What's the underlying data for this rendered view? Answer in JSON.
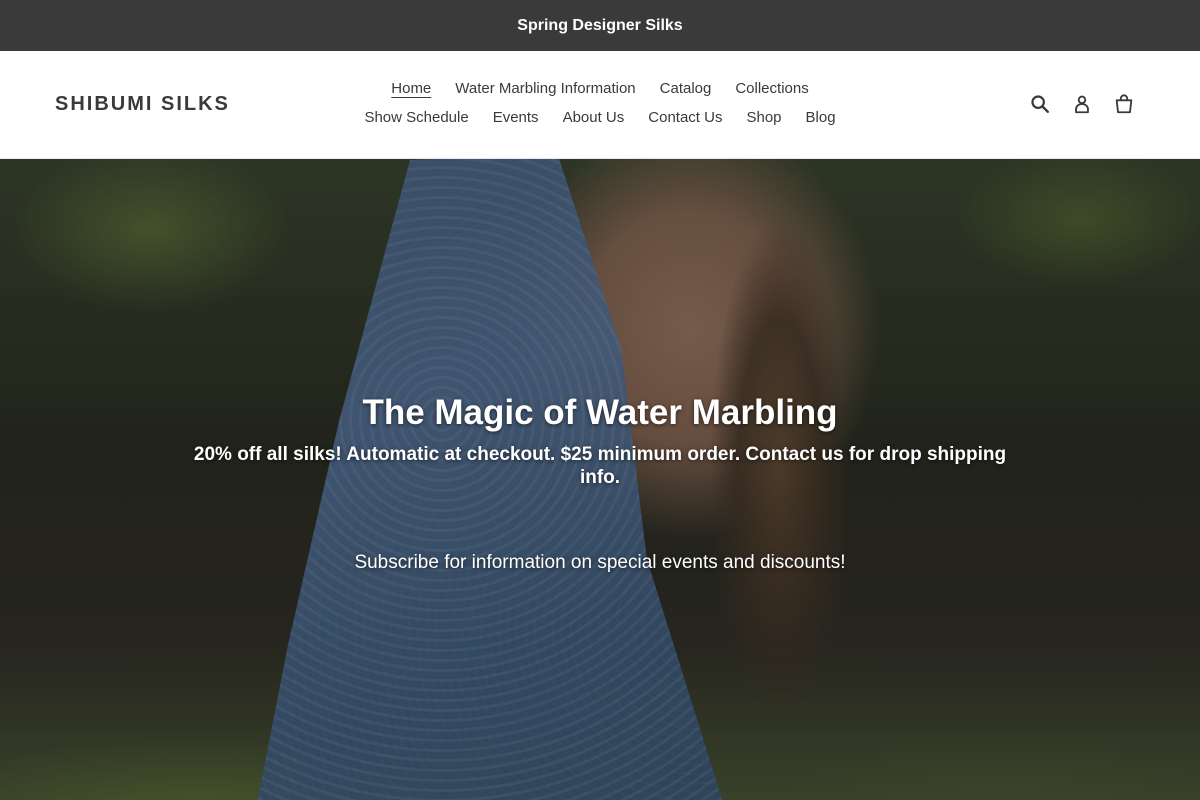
{
  "announcement": {
    "text": "Spring Designer Silks"
  },
  "header": {
    "logo": "SHIBUMI SILKS",
    "nav_row1": [
      {
        "label": "Home",
        "active": true
      },
      {
        "label": "Water Marbling Information"
      },
      {
        "label": "Catalog"
      },
      {
        "label": "Collections"
      }
    ],
    "nav_row2": [
      {
        "label": "Show Schedule"
      },
      {
        "label": "Events"
      },
      {
        "label": "About Us"
      },
      {
        "label": "Contact Us"
      },
      {
        "label": "Shop"
      },
      {
        "label": "Blog"
      }
    ],
    "icons": [
      "search-icon",
      "account-icon",
      "cart-icon"
    ]
  },
  "hero": {
    "title": "The Magic of Water Marbling",
    "subtitle": "20% off all silks! Automatic at checkout. $25 minimum order. Contact us for drop shipping info.",
    "subscribe_text": "Subscribe for information on special events and discounts!"
  },
  "colors": {
    "announcement_bg": "#3a3a3a",
    "text_dark": "#3a3a3a",
    "white": "#ffffff"
  }
}
